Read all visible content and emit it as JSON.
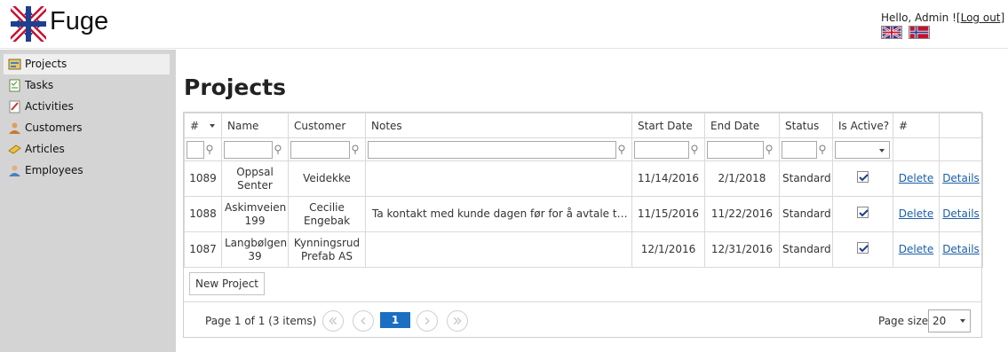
{
  "header": {
    "brand": "Fuge",
    "greeting": "Hello, Admin !",
    "logout": "[Log out]",
    "flags": [
      "flag-uk-icon",
      "flag-norway-icon"
    ]
  },
  "sidebar": {
    "items": [
      {
        "label": "Projects",
        "icon": "projects-icon",
        "active": true
      },
      {
        "label": "Tasks",
        "icon": "tasks-icon"
      },
      {
        "label": "Activities",
        "icon": "activities-icon"
      },
      {
        "label": "Customers",
        "icon": "customers-icon"
      },
      {
        "label": "Articles",
        "icon": "articles-icon"
      },
      {
        "label": "Employees",
        "icon": "employees-icon"
      }
    ]
  },
  "page": {
    "title": "Projects"
  },
  "grid": {
    "columns": [
      "#",
      "Name",
      "Customer",
      "Notes",
      "Start Date",
      "End Date",
      "Status",
      "Is Active?",
      "#",
      ""
    ],
    "rows": [
      {
        "id": "1089",
        "name": "Oppsal Senter",
        "customer": "Veidekke",
        "notes": "",
        "start": "11/14/2016",
        "end": "2/1/2018",
        "status": "Standard",
        "active": true,
        "delete": "Delete",
        "details": "Details"
      },
      {
        "id": "1088",
        "name": "Askimveien 199",
        "customer": "Cecilie Engebak",
        "notes": "Ta kontakt med kunde dagen før for å avtale tidspu...",
        "start": "11/15/2016",
        "end": "11/22/2016",
        "status": "Standard",
        "active": true,
        "delete": "Delete",
        "details": "Details"
      },
      {
        "id": "1087",
        "name": "Langbølgen 39",
        "customer": "Kynningsrud Prefab AS",
        "notes": "",
        "start": "12/1/2016",
        "end": "12/31/2016",
        "status": "Standard",
        "active": true,
        "delete": "Delete",
        "details": "Details"
      }
    ],
    "new_button": "New Project",
    "pager": {
      "info": "Page 1 of 1 (3 items)",
      "current_page": "1",
      "page_size_label": "Page size:",
      "page_size": "20"
    }
  },
  "colors": {
    "accent": "#1b6ec2",
    "sidebar_bg": "#d4d4d4",
    "link": "#1a5fa8"
  }
}
